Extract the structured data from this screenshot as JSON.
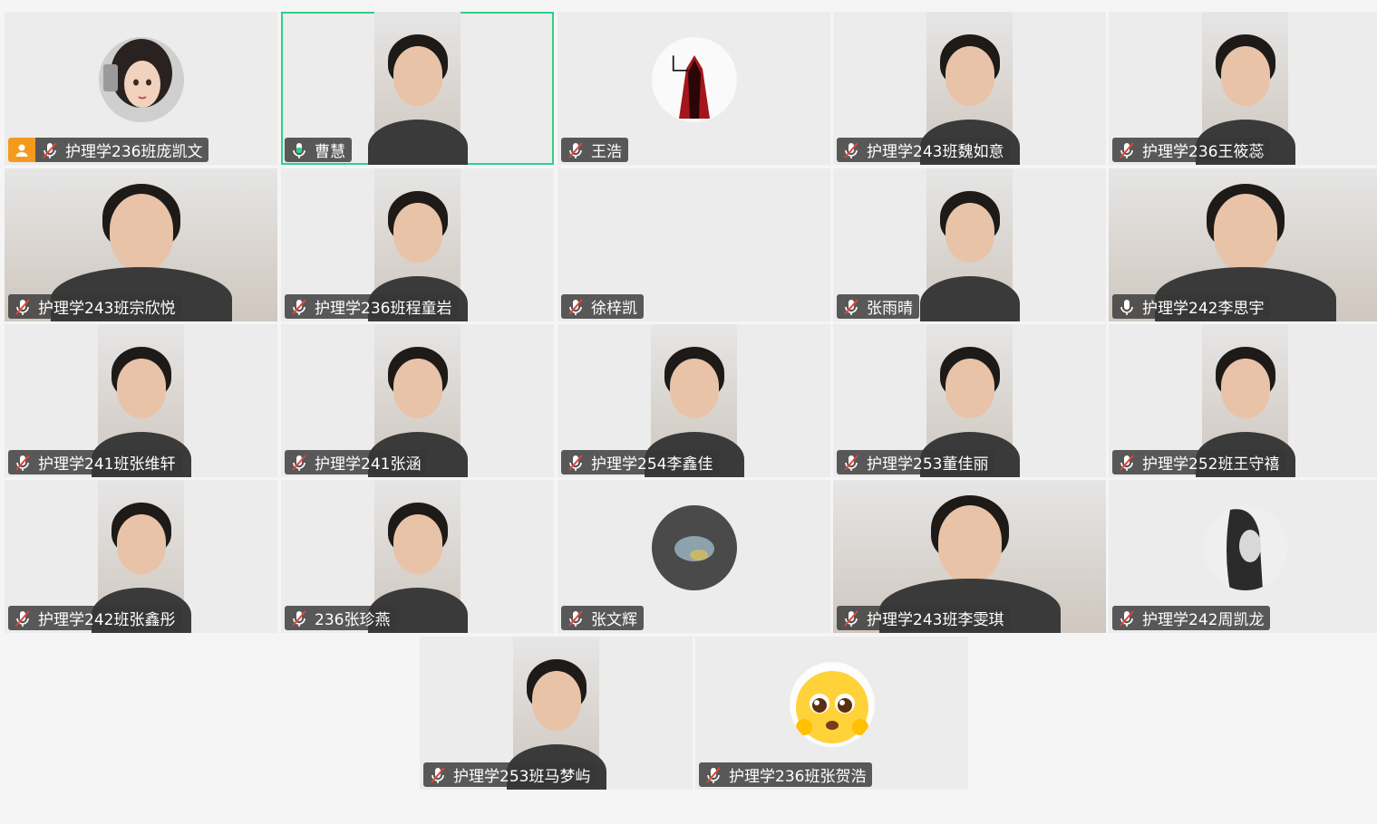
{
  "participants": [
    {
      "name": "护理学236班庞凯文",
      "mic": "muted",
      "host": true,
      "media": "avatar",
      "avatar": "cartoon-girl"
    },
    {
      "name": "曹慧",
      "mic": "speaking",
      "speaking": true,
      "media": "video"
    },
    {
      "name": "王浩",
      "mic": "muted",
      "media": "avatar",
      "avatar": "red-figure"
    },
    {
      "name": "护理学243班魏如意",
      "mic": "muted",
      "media": "video"
    },
    {
      "name": "护理学236王筱蕊",
      "mic": "muted",
      "media": "video"
    },
    {
      "name": "护理学243班宗欣悦",
      "mic": "muted",
      "media": "video-wide"
    },
    {
      "name": "护理学236班程童岩",
      "mic": "muted",
      "media": "video"
    },
    {
      "name": "徐梓凯",
      "mic": "muted",
      "media": "none"
    },
    {
      "name": "张雨晴",
      "mic": "muted",
      "media": "video"
    },
    {
      "name": "护理学242李思宇",
      "mic": "on",
      "media": "video-wide"
    },
    {
      "name": "护理学241班张维轩",
      "mic": "muted",
      "media": "video"
    },
    {
      "name": "护理学241张涵",
      "mic": "muted",
      "media": "video"
    },
    {
      "name": "护理学254李鑫佳",
      "mic": "muted",
      "media": "video"
    },
    {
      "name": "护理学253董佳丽",
      "mic": "muted",
      "media": "video"
    },
    {
      "name": "护理学252班王守禧",
      "mic": "muted",
      "media": "video"
    },
    {
      "name": "护理学242班张鑫彤",
      "mic": "muted",
      "media": "video"
    },
    {
      "name": "236张珍燕",
      "mic": "muted",
      "media": "video"
    },
    {
      "name": "张文辉",
      "mic": "muted",
      "media": "avatar",
      "avatar": "dark-photo"
    },
    {
      "name": "护理学243班李雯琪",
      "mic": "muted",
      "media": "video-wide"
    },
    {
      "name": "护理学242周凯龙",
      "mic": "muted",
      "media": "avatar",
      "avatar": "sketch-portrait"
    },
    {
      "name": "护理学253班马梦屿",
      "mic": "muted",
      "media": "video"
    },
    {
      "name": "护理学236班张贺浩",
      "mic": "muted",
      "media": "avatar",
      "avatar": "pleading-emoji"
    }
  ],
  "colors": {
    "speaking_border": "#2fcf8a",
    "host_badge": "#f49b1f",
    "muted_slash": "#e0453a",
    "tag_bg": "rgba(55,55,55,0.82)"
  },
  "icons": {
    "mic_muted": "mic-muted-icon",
    "mic_on": "mic-icon",
    "mic_speaking": "mic-speaking-icon",
    "host": "person-icon"
  }
}
